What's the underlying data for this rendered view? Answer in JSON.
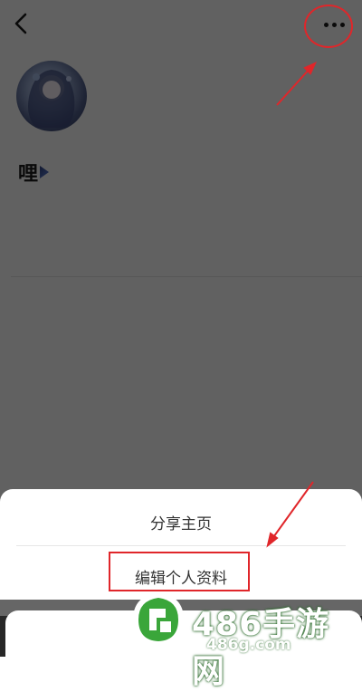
{
  "profile": {
    "username": "哩"
  },
  "sheet": {
    "share_label": "分享主页",
    "edit_label": "编辑个人资料"
  },
  "watermark": {
    "brand": "486手游网",
    "domain": "486g.com"
  },
  "icons": {
    "back": "back-arrow-icon",
    "more": "more-dots-icon"
  },
  "colors": {
    "annotation_red": "#e0262a",
    "watermark_green": "#3aa63a"
  }
}
